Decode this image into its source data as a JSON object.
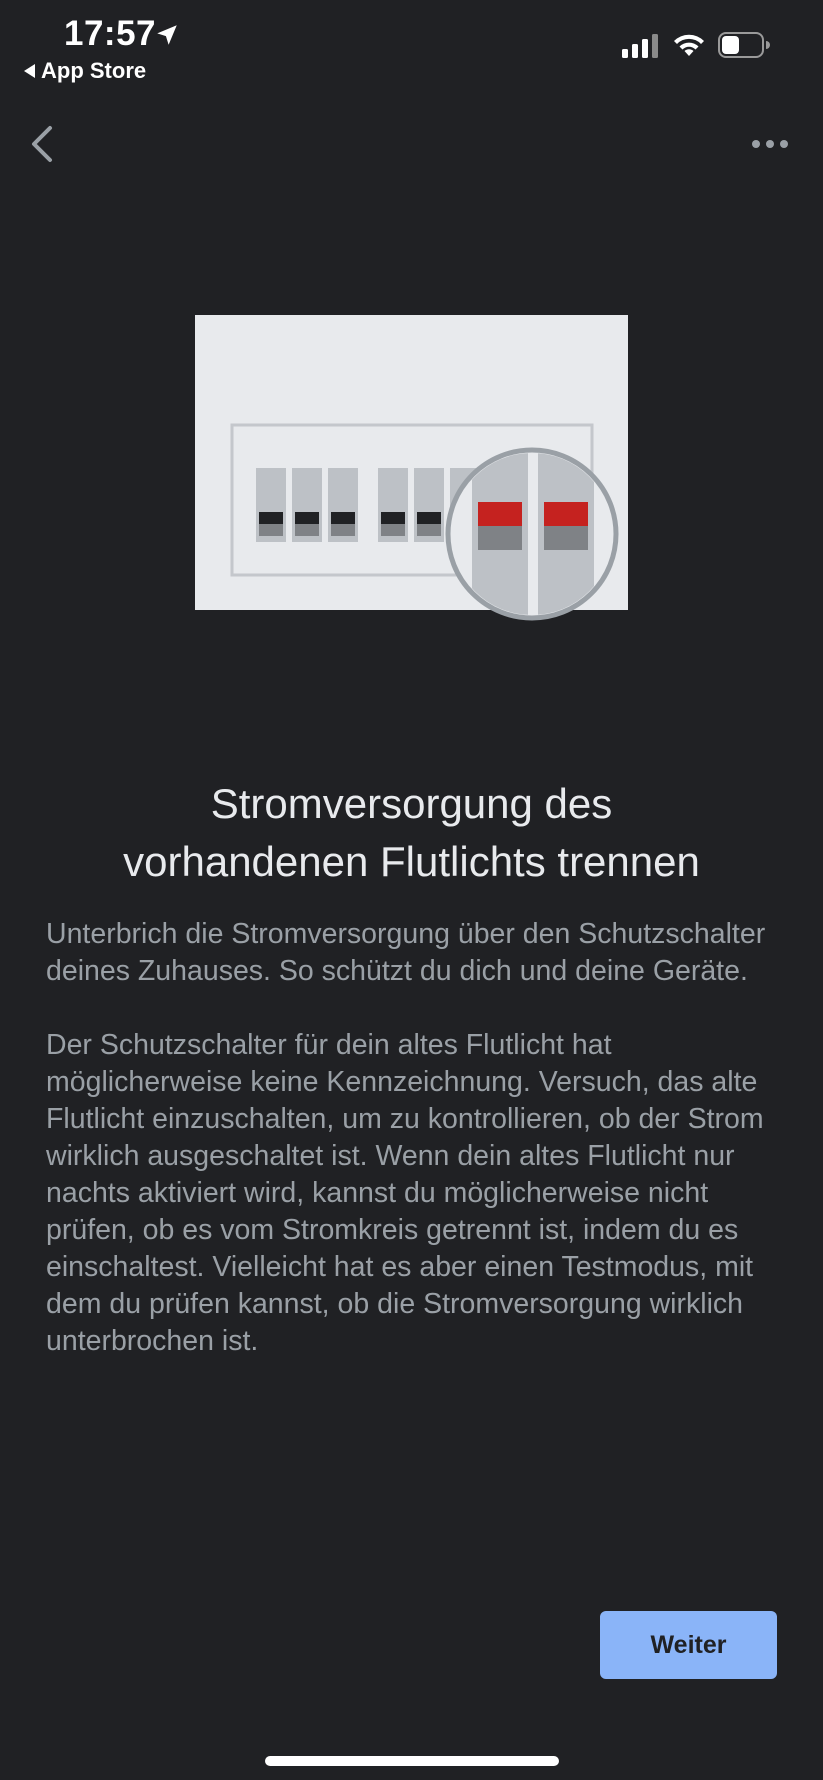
{
  "status_bar": {
    "time": "17:57",
    "back_app_label": "App Store",
    "location_icon": "location-arrow-icon",
    "signal_icon": "cellular-signal-icon",
    "wifi_icon": "wifi-icon",
    "battery_icon": "battery-icon",
    "battery_level": 0.45
  },
  "app_bar": {
    "back_icon": "chevron-left-icon",
    "more_icon": "more-horizontal-icon"
  },
  "illustration": {
    "name": "circuit-breaker-panel",
    "breaker_colors": {
      "panel": "#e8eaed",
      "switch": "#bdc1c6",
      "off_handle": "#202124",
      "highlight_handle": "#c5221f"
    }
  },
  "content": {
    "title_line1": "Stromversorgung des",
    "title_line2": "vorhandenen Flutlichts trennen",
    "paragraph1": "Unterbrich die Stromversorgung über den Schutzschalter deines Zuhauses. So schützt du dich und deine Geräte.",
    "paragraph2": "Der Schutzschalter für dein altes Flutlicht hat möglicherweise keine Kennzeichnung. Versuch, das alte Flutlicht einzuschalten, um zu kontrollieren, ob der Strom wirklich ausgeschaltet ist. Wenn dein altes Flutlicht nur nachts aktiviert wird, kannst du möglicherweise nicht prüfen, ob es vom Stromkreis getrennt ist, indem du es einschaltest. Vielleicht hat es aber einen Testmodus, mit dem du prüfen kannst, ob die Stromversorgung wirklich unterbrochen ist."
  },
  "actions": {
    "continue_label": "Weiter"
  },
  "colors": {
    "background": "#202124",
    "title": "#e8eaed",
    "body": "#9aa0a6",
    "button_bg": "#8ab4f8",
    "button_text": "#202124"
  }
}
